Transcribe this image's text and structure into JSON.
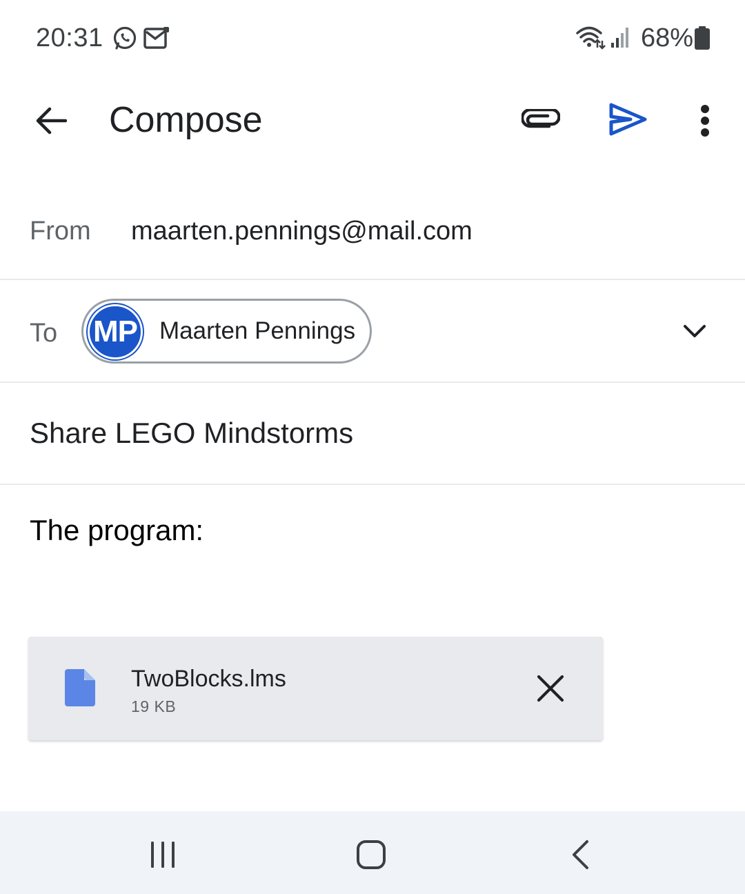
{
  "status_bar": {
    "time": "20:31",
    "battery": "68%",
    "icons": [
      "whatsapp-icon",
      "mail-notification-icon",
      "wifi-icon",
      "signal-icon",
      "battery-icon"
    ]
  },
  "app_bar": {
    "title": "Compose",
    "icons": [
      "back-arrow-icon",
      "attach-icon",
      "send-icon",
      "more-vert-icon"
    ],
    "accent_color": "#1a55c9"
  },
  "compose": {
    "from_label": "From",
    "from_value": "maarten.pennings@mail.com",
    "to_label": "To",
    "recipient": {
      "initials": "MP",
      "name": "Maarten Pennings",
      "avatar_color": "#1a55c9"
    },
    "subject": "Share LEGO Mindstorms",
    "body": "The program:"
  },
  "attachment": {
    "file_name": "TwoBlocks.lms",
    "file_size": "19 KB",
    "file_icon_color": "#5b86e5"
  },
  "nav_bar": {
    "buttons": [
      "recents-icon",
      "home-icon",
      "back-icon"
    ]
  }
}
